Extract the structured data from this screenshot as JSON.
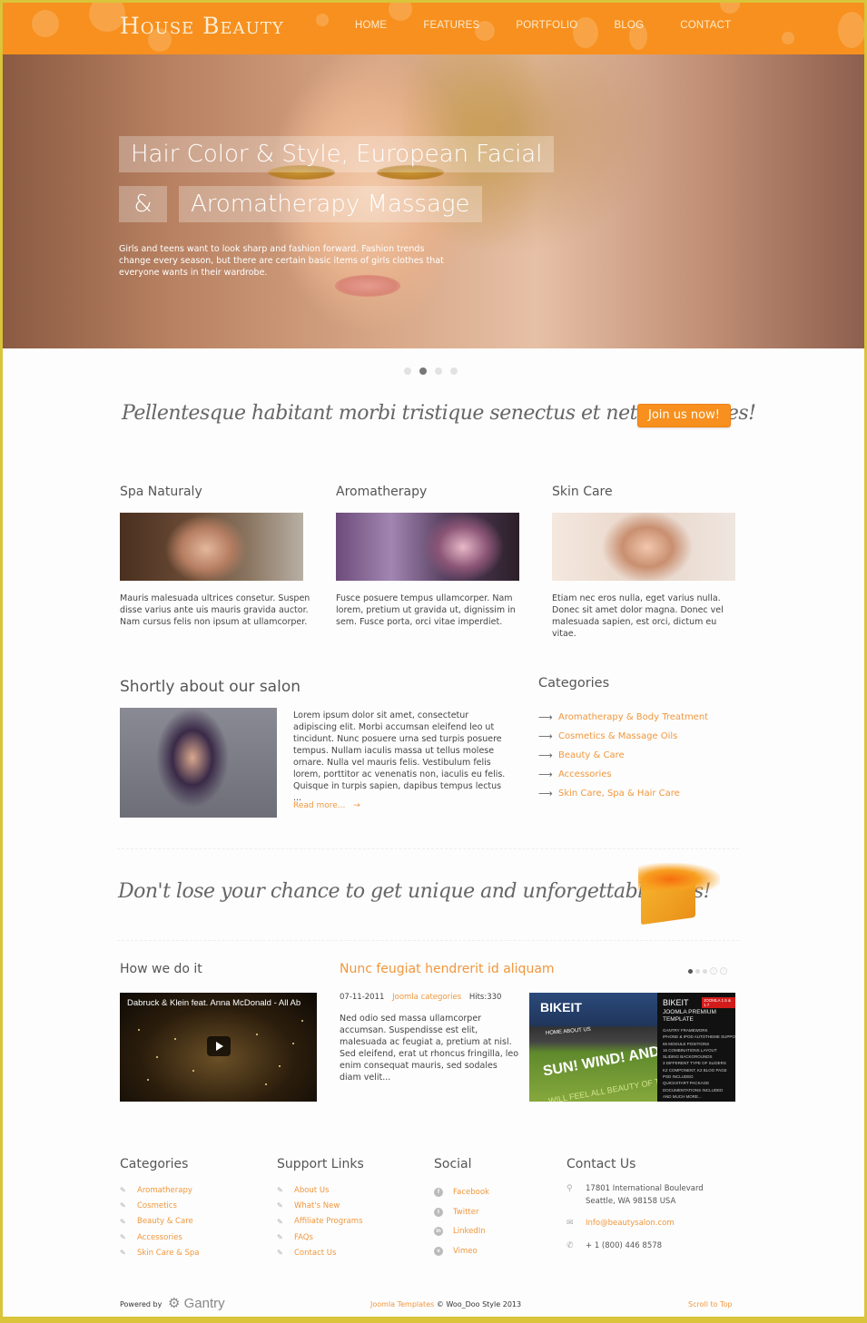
{
  "header": {
    "logo": "House Beauty",
    "nav": [
      "HOME",
      "FEATURES",
      "PORTFOLIO",
      "BLOG",
      "CONTACT"
    ]
  },
  "hero": {
    "line1": "Hair Color & Style, European Facial",
    "line2_amp": "&",
    "line2": "Aromatherapy Massage",
    "description": "Girls and teens want to look sharp and fashion forward. Fashion trends change every season, but there are certain basic items of girls clothes that everyone wants in their wardrobe.",
    "slides": 4,
    "active_slide": 2
  },
  "cta": {
    "text": "Pellentesque habitant morbi tristique senectus et netus et fames!",
    "button": "Join us now!"
  },
  "features": [
    {
      "title": "Spa Naturaly",
      "text": "Mauris malesuada ultrices consetur. Suspen disse varius ante uis mauris gravida auctor. Nam cursus felis non ipsum at ullamcorper."
    },
    {
      "title": "Aromatherapy",
      "text": "Fusce posuere tempus ullamcorper. Nam lorem, pretium ut gravida ut, dignissim in sem. Fusce porta, orci vitae imperdiet."
    },
    {
      "title": "Skin Care",
      "text": "Etiam nec eros nulla, eget varius nulla. Donec sit amet dolor magna. Donec vel malesuada sapien, est orci, dictum eu vitae."
    }
  ],
  "about": {
    "title": "Shortly about our salon",
    "text": "Lorem ipsum dolor sit amet, consectetur adipiscing elit. Morbi accumsan eleifend leo ut tincidunt. Nunc posuere urna sed turpis posuere tempus. Nullam iaculis massa ut tellus molese ornare. Nulla vel mauris felis. Vestibulum felis lorem, porttitor ac venenatis non, iaculis eu felis. Quisque in turpis sapien, dapibus tempus lectus ...",
    "read_more": "Read more...",
    "read_more_arrow": "→"
  },
  "categories": {
    "title": "Categories",
    "arrow": "⟶",
    "items": [
      "Aromatherapy & Body Treatment",
      "Cosmetics & Massage Oils",
      "Beauty & Care",
      "Accessories",
      "Skin Care, Spa & Hair Care"
    ]
  },
  "gift_banner": {
    "text": "Don't lose your chance to get unique and unforgettable gifts!"
  },
  "how": {
    "title": "How we do it",
    "video_title": "Dabruck & Klein feat. Anna McDonald - All Ab"
  },
  "article": {
    "title": "Nunc feugiat hendrerit id aliquam",
    "date": "07-11-2011",
    "category": "Joomla categories",
    "hits": "Hits:330",
    "text": "Ned odio sed massa ullamcorper accumsan. Suspendisse est elit, malesuada ac feugiat a, pretium at nisl. Sed eleifend, erat ut rhoncus fringilla, leo enim consequat mauris, sed sodales diam velit..."
  },
  "promo": {
    "logo": "BIKEIT",
    "name": "BIKEIT",
    "subtitle": "JOOMLA PREMIUM TEMPLATE",
    "badge": "JOOMLA 1.5 & 1.7",
    "nav": "HOME      ABOUT US",
    "headline": "SUN! WIND! AND A RIDE!",
    "tagline": "WILL FEEL ALL BEAUTY OF THE NATURE",
    "features": "GANTRY FRAMEWORK\nIPHONE & IPOD AUTOTHEME SUPPORT\n65 MODULE POSITIONS\n16 COMBINATIONS LAYOUT\nSLIDING BACKGROUNDS\n3 DIFFERENT TYPE OF SLIDERS\nK2 COMPONENT, K2 BLOG PAGE\nPSD INCLUDED\nQUICKSTART PACKAGE\nDOCUMENTATIONS INCLUDED\nAND MUCH MORE..."
  },
  "carousel": {
    "pages": 3,
    "active_page": 1,
    "prev": "‹",
    "next": "›"
  },
  "footer": {
    "categories": {
      "title": "Categories",
      "items": [
        "Aromatherapy",
        "Cosmetics",
        "Beauty & Care",
        "Accessories",
        "Skin Care & Spa"
      ]
    },
    "support": {
      "title": "Support Links",
      "items": [
        "About Us",
        "What's New",
        "Affiliate Programs",
        "FAQs",
        "Contact Us"
      ]
    },
    "social": {
      "title": "Social",
      "items": [
        {
          "label": "Facebook",
          "icon": "f"
        },
        {
          "label": "Twitter",
          "icon": "t"
        },
        {
          "label": "LinkedIn",
          "icon": "in"
        },
        {
          "label": "Vimeo",
          "icon": "v"
        }
      ]
    },
    "contact": {
      "title": "Contact Us",
      "address1": "17801 International Boulevard",
      "address2": "Seattle, WA 98158 USA",
      "email": "Info@beautysalon.com",
      "phone": "+ 1 (800) 446 8578"
    }
  },
  "bottom": {
    "powered_by": "Powered by",
    "gantry": "Gantry",
    "templates_link": "Joomla Templates",
    "copyright": "© Woo_Doo Style 2013",
    "scroll_top": "Scroll to Top"
  },
  "colors": {
    "accent": "#f7901e",
    "link": "#f0973d",
    "frame": "#d9c43a"
  }
}
